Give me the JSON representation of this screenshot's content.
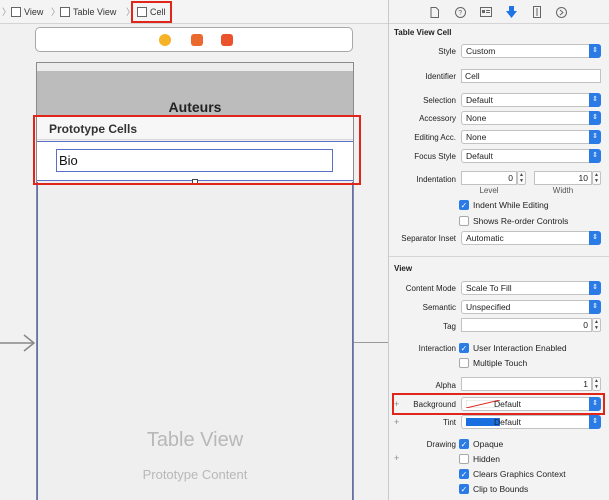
{
  "breadcrumbs": [
    {
      "label": "View"
    },
    {
      "label": "Table View"
    },
    {
      "label": "Cell"
    }
  ],
  "canvas": {
    "nav_title": "Auteurs",
    "section_header": "Prototype Cells",
    "cell_text": "Bio",
    "table_view_label": "Table View",
    "table_view_sub": "Prototype Content"
  },
  "scene_icons": [
    "view-controller-icon",
    "first-responder-icon",
    "exit-icon"
  ],
  "inspector": {
    "tab_icons": [
      "file-icon",
      "help-icon",
      "identity-icon",
      "attributes-icon",
      "size-icon",
      "connections-icon"
    ],
    "section1_title": "Table View Cell",
    "style_label": "Style",
    "style_value": "Custom",
    "identifier_label": "Identifier",
    "identifier_value": "Cell",
    "selection_label": "Selection",
    "selection_value": "Default",
    "accessory_label": "Accessory",
    "accessory_value": "None",
    "editing_acc_label": "Editing Acc.",
    "editing_acc_value": "None",
    "focus_style_label": "Focus Style",
    "focus_style_value": "Default",
    "indentation_label": "Indentation",
    "level_value": "0",
    "level_label": "Level",
    "width_value": "10",
    "width_label": "Width",
    "indent_while_editing": "Indent While Editing",
    "show_reorder": "Shows Re-order Controls",
    "separator_inset_label": "Separator Inset",
    "separator_inset_value": "Automatic",
    "section2_title": "View",
    "content_mode_label": "Content Mode",
    "content_mode_value": "Scale To Fill",
    "semantic_label": "Semantic",
    "semantic_value": "Unspecified",
    "tag_label": "Tag",
    "tag_value": "0",
    "interaction_label": "Interaction",
    "user_interaction": "User Interaction Enabled",
    "multiple_touch": "Multiple Touch",
    "alpha_label": "Alpha",
    "alpha_value": "1",
    "background_label": "Background",
    "background_value": "Default",
    "tint_label": "Tint",
    "tint_value": "Default",
    "drawing_label": "Drawing",
    "opaque": "Opaque",
    "hidden": "Hidden",
    "clears_graphics": "Clears Graphics Context",
    "clip_to_bounds": "Clip to Bounds"
  },
  "colors": {
    "accent": "#2b7be7",
    "highlight": "#e0261b",
    "tint_swatch": "#1a6fe0"
  }
}
